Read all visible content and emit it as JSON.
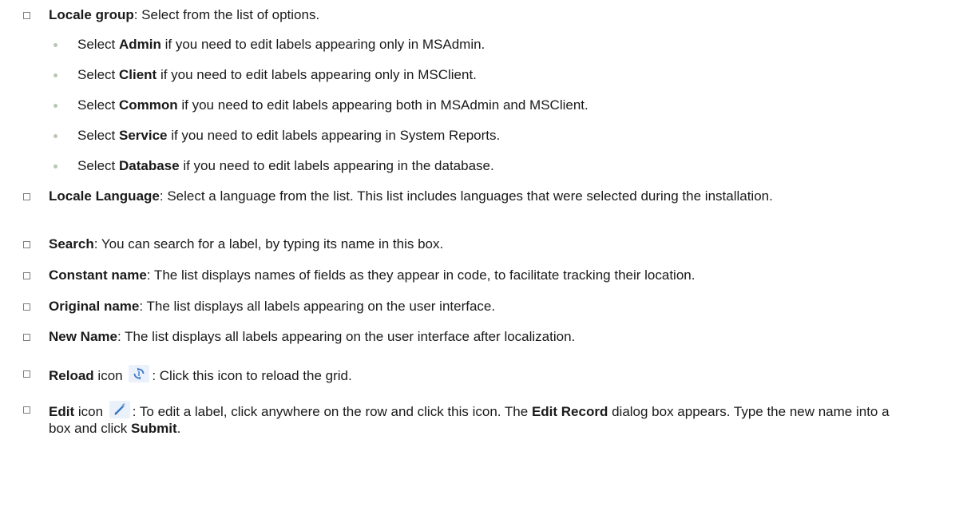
{
  "items": [
    {
      "term": "Locale group",
      "rest": ": Select from the list of options."
    },
    {
      "term": "Locale Language",
      "rest": ": Select a language from the list. This list includes languages that were selected during the installation."
    },
    {
      "term": "Search",
      "rest": ": You can search for a label, by typing its name in this box."
    },
    {
      "term": "Constant name",
      "rest": ": The list displays names of fields as they appear in code, to facilitate tracking their location."
    },
    {
      "term": "Original name",
      "rest": ": The list displays all labels appearing on the user interface."
    },
    {
      "term": "New Name",
      "rest": ": The list displays all labels appearing on the user interface after localization."
    },
    {
      "term": "Reload",
      "mid": " icon ",
      "icon": "reload-icon",
      "rest": ": Click this icon to reload the grid."
    },
    {
      "term": "Edit",
      "mid": " icon ",
      "icon": "pencil-icon",
      "rest_a": ": To edit a label, click anywhere on the row and click this icon. The ",
      "bold_a": "Edit Record",
      "rest_b": " dialog box appears. Type the new name into a box and click ",
      "bold_b": "Submit",
      "rest_c": "."
    }
  ],
  "subitems": [
    {
      "pre": "Select ",
      "term": "Admin",
      "rest": " if you need to edit labels appearing only in MSAdmin."
    },
    {
      "pre": "Select ",
      "term": "Client",
      "rest": " if you need to edit labels appearing only in MSClient."
    },
    {
      "pre": "Select ",
      "term": "Common",
      "rest": " if you need to edit labels appearing both in MSAdmin and MSClient."
    },
    {
      "pre": "Select ",
      "term": "Service",
      "rest": " if you need to edit labels appearing in System Reports."
    },
    {
      "pre": "Select ",
      "term": "Database",
      "rest": " if you need to edit labels appearing in the database."
    }
  ],
  "colors": {
    "text": "#1a1a1a",
    "checkbox_border": "#7d7d7d",
    "sub_bullet": "#b9c7b4",
    "icon_bg": "#eaf1fa",
    "icon_blue": "#3a78c9"
  }
}
